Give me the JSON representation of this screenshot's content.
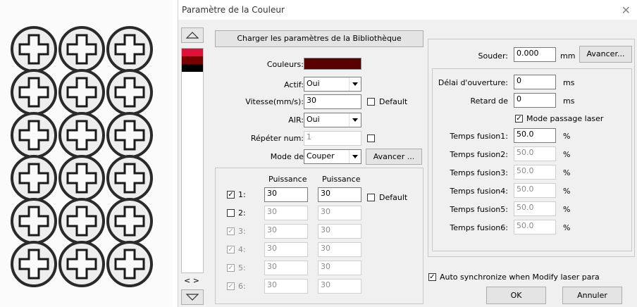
{
  "window": {
    "title": "Paramètre de la Couleur"
  },
  "layer_list": {
    "colors": [
      "#e0103a",
      "#7a0000",
      "#000000"
    ],
    "nav_label": "< >"
  },
  "load_library_button": "Charger les paramètres de la Bibliothèque",
  "colors_row": {
    "label": "Couleurs:",
    "swatch": "#5a0000"
  },
  "actif": {
    "label": "Actif:",
    "value": "Oui"
  },
  "speed": {
    "label": "Vitesse(mm/s):",
    "value": "30",
    "default_label": "Default"
  },
  "air": {
    "label": "AIR:",
    "value": "Oui"
  },
  "repeat": {
    "label": "Répéter num:",
    "value": "1"
  },
  "mode": {
    "label": "Mode de",
    "value": "Couper",
    "advance_label": "Avancer ..."
  },
  "power": {
    "header1": "Puissance",
    "header2": "Puissance",
    "default_label": "Default",
    "rows": [
      {
        "label": "1:",
        "v1": "30",
        "v2": "30",
        "checked": true,
        "enabled": true
      },
      {
        "label": "2:",
        "v1": "30",
        "v2": "30",
        "checked": false,
        "enabled": true
      },
      {
        "label": "3:",
        "v1": "30",
        "v2": "30",
        "checked": true,
        "enabled": false
      },
      {
        "label": "4:",
        "v1": "30",
        "v2": "30",
        "checked": true,
        "enabled": false
      },
      {
        "label": "5:",
        "v1": "30",
        "v2": "30",
        "checked": true,
        "enabled": false
      },
      {
        "label": "6:",
        "v1": "30",
        "v2": "30",
        "checked": true,
        "enabled": false
      }
    ]
  },
  "souder": {
    "label": "Souder:",
    "value": "0.000",
    "unit": "mm",
    "advance_label": "Avancer..."
  },
  "delay_open": {
    "label": "Délai d'ouverture:",
    "value": "0",
    "unit": "ms"
  },
  "delay_close": {
    "label": "Retard de",
    "value": "0",
    "unit": "ms"
  },
  "pass_mode": {
    "label": "Mode passage laser",
    "checked": true
  },
  "fusion": [
    {
      "label": "Temps fusion1:",
      "value": "50.0",
      "unit": "%",
      "enabled": true
    },
    {
      "label": "Temps fusion2:",
      "value": "50.0",
      "unit": "%",
      "enabled": false
    },
    {
      "label": "Temps fusion3:",
      "value": "50.0",
      "unit": "%",
      "enabled": false
    },
    {
      "label": "Temps fusion4:",
      "value": "50.0",
      "unit": "%",
      "enabled": false
    },
    {
      "label": "Temps fusion5:",
      "value": "50.0",
      "unit": "%",
      "enabled": false
    },
    {
      "label": "Temps fusion6:",
      "value": "50.0",
      "unit": "%",
      "enabled": false
    }
  ],
  "auto_sync": {
    "label": "Auto synchronize when Modify laser para",
    "checked": true
  },
  "ok_label": "OK",
  "cancel_label": "Annuler"
}
